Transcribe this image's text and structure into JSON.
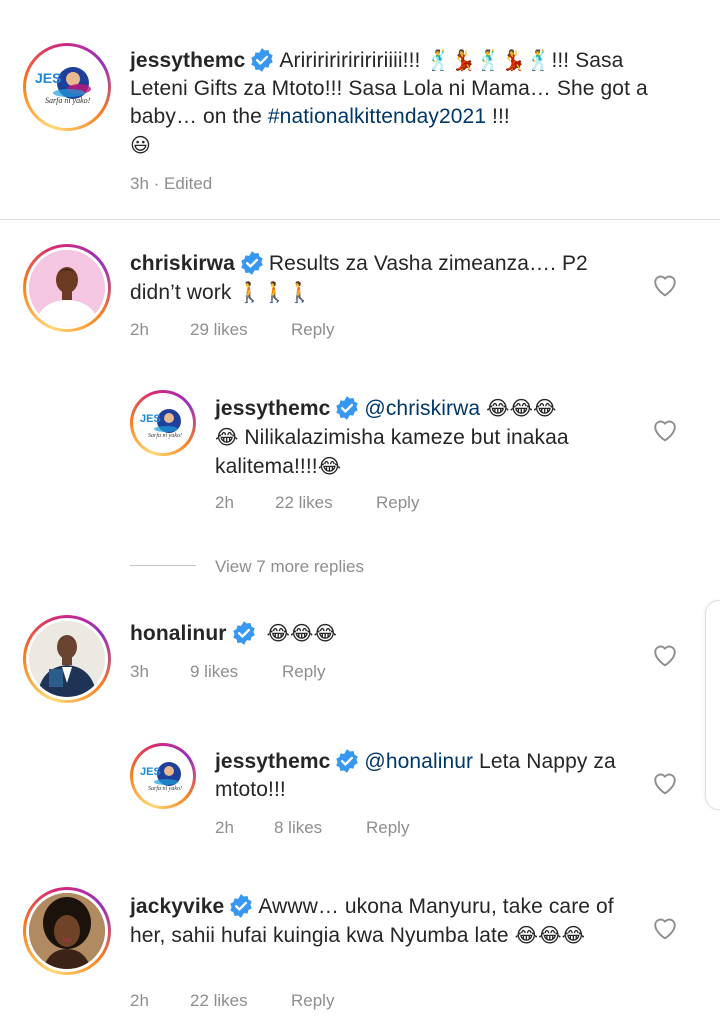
{
  "post_caption": {
    "username": "jessythemc",
    "text_1": "Aririririririririiii!!! ",
    "emoji_dance": "🕺💃🕺💃🕺",
    "text_2": "!!! Sasa Leteni Gifts za Mtoto!!! Sasa Lola ni Mama… She got a baby… on the ",
    "hashtag": "#nationalkittenday2021",
    "text_3": " !!!",
    "emoji_smile": "😃",
    "time": "3h",
    "edited": "Edited",
    "avatar_logo": "JESSY",
    "avatar_tagline": "Sarfa ni yako!"
  },
  "comments": [
    {
      "username": "chriskirwa",
      "text": "Results za Vasha zimeanza…. P2 didn’t work ",
      "emoji": "🚶🚶🚶",
      "time": "2h",
      "likes": "29 likes",
      "reply": "Reply"
    },
    {
      "username": "jessythemc",
      "mention": "@chriskirwa",
      "emoji_a": "😂😂😂",
      "emoji_b": "😂",
      "text": " Nilikalazimisha kameze but inakaa kalitema!!!!",
      "emoji_c": "😂",
      "time": "2h",
      "likes": "22 likes",
      "reply": "Reply"
    },
    {
      "view_more": "View 7 more replies"
    },
    {
      "username": "honalinur",
      "emoji": "😂😂😂",
      "time": "3h",
      "likes": "9 likes",
      "reply": "Reply"
    },
    {
      "username": "jessythemc",
      "mention": "@honalinur",
      "text": " Leta Nappy za mtoto!!!",
      "time": "2h",
      "likes": "8 likes",
      "reply": "Reply"
    },
    {
      "username": "jackyvike",
      "text": "Awww… ukona Manyuru, take care of her, sahii hufai kuingia kwa Nyumba late ",
      "emoji": "😂😂😂",
      "time": "2h",
      "likes": "22 likes",
      "reply": "Reply"
    }
  ],
  "colors": {
    "verified_blue": "#3897f0",
    "meta_gray": "#8e8e8e",
    "link_blue": "#00376b"
  },
  "icons": [
    "verified-badge-icon",
    "heart-outline-icon"
  ]
}
